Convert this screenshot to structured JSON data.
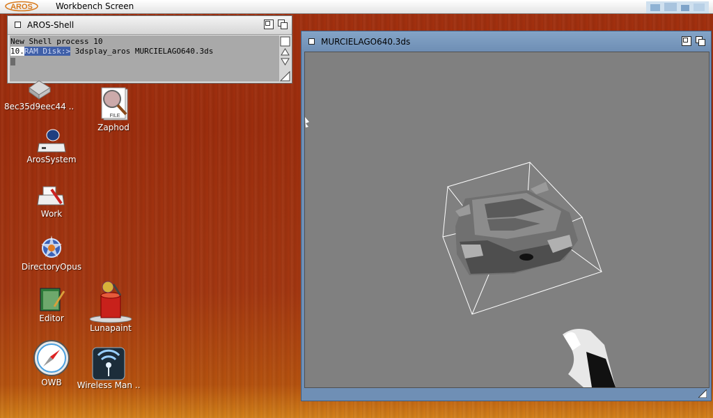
{
  "screen": {
    "title": "Workbench Screen",
    "logo_text": "AROS"
  },
  "shell": {
    "title": "AROS-Shell",
    "line1": "New Shell process 10",
    "prompt_num": "10.",
    "prompt_path": "RAM Disk:>",
    "command": " 3dsplay_aros MURCIELAGO640.3ds"
  },
  "viewer": {
    "title": "MURCIELAGO640.3ds"
  },
  "icons": [
    {
      "label": "8ec35d9eec44 ..",
      "icon": "drive-icon"
    },
    {
      "label": "Zaphod",
      "icon": "file-icon"
    },
    {
      "label": "ArosSystem",
      "icon": "system-drive-icon"
    },
    {
      "label": "Work",
      "icon": "work-drive-icon"
    },
    {
      "label": "DirectoryOpus",
      "icon": "directory-opus-icon"
    },
    {
      "label": "Editor",
      "icon": "editor-icon"
    },
    {
      "label": "Lunapaint",
      "icon": "paint-icon"
    },
    {
      "label": "OWB",
      "icon": "compass-icon"
    },
    {
      "label": "Wireless Man ..",
      "icon": "wireless-icon"
    }
  ],
  "colors": {
    "desktop": "#a2300f",
    "viewer_frame": "#6f8fb5",
    "viewport": "#808080",
    "shell_bg": "#a9a9a9"
  }
}
